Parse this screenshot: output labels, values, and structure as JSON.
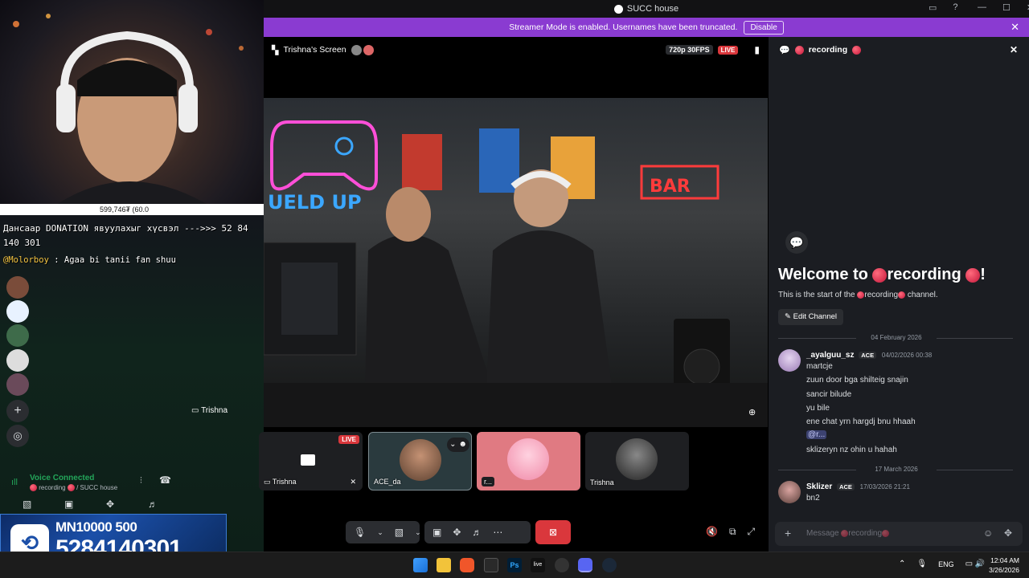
{
  "window": {
    "title": "SUCC house"
  },
  "banner": {
    "text": "Streamer Mode is enabled. Usernames have been truncated.",
    "button": "Disable"
  },
  "stage": {
    "screen_title": "Trishna's Screen",
    "quality": "720p 30FPS",
    "live": "LIVE",
    "sharer_label": "Trishna"
  },
  "overlay": {
    "alert_text": "599,746₮ (60.0",
    "ticker_line1": "Дансаар DONATION явуулахыг хүсвэл --->>> 52 84",
    "ticker_line2": "140 301",
    "chat_user": "@Molorboy",
    "chat_msg": ": Agaa bi tanii fan shuu",
    "donation_top": "MN10000 500",
    "donation_number": "5284140301"
  },
  "voice": {
    "status": "Voice Connected",
    "channel": "recording",
    "server": "/ SUCC house"
  },
  "tiles": [
    {
      "name": "Trishna",
      "live": "LIVE"
    },
    {
      "name": "ACE_da"
    },
    {
      "name": "r..."
    },
    {
      "name": "Trishna"
    }
  ],
  "chat": {
    "channel": "recording",
    "welcome_prefix": "Welcome to",
    "welcome_suffix": "!",
    "start_prefix": "This is the start of the",
    "start_suffix": "channel.",
    "edit_channel": "Edit Channel",
    "divider1": "04 February 2026",
    "msg1": {
      "author": "_ayalguu_sz",
      "badge": "ACE",
      "time": "04/02/2026 00:38",
      "lines": [
        "martcje",
        "zuun door bga shilteig snajin",
        "sancir bilude",
        "yu bile",
        "ene chat yrn hargdj bnu hhaah",
        "@r...",
        "sklizeryn nz ohin u hahah"
      ]
    },
    "divider2": "17 March 2026",
    "msg2": {
      "author": "Sklizer",
      "badge": "ACE",
      "time": "17/03/2026 21:21",
      "lines": [
        "bn2"
      ]
    },
    "placeholder": "Message",
    "placeholder_channel": "recording"
  },
  "taskbar": {
    "lang": "ENG",
    "time": "12:04 AM",
    "date": "3/26/2026"
  },
  "colors": {
    "accent": "#8a3bd1",
    "live": "#da373c",
    "chat_bg": "#1b1d22"
  }
}
